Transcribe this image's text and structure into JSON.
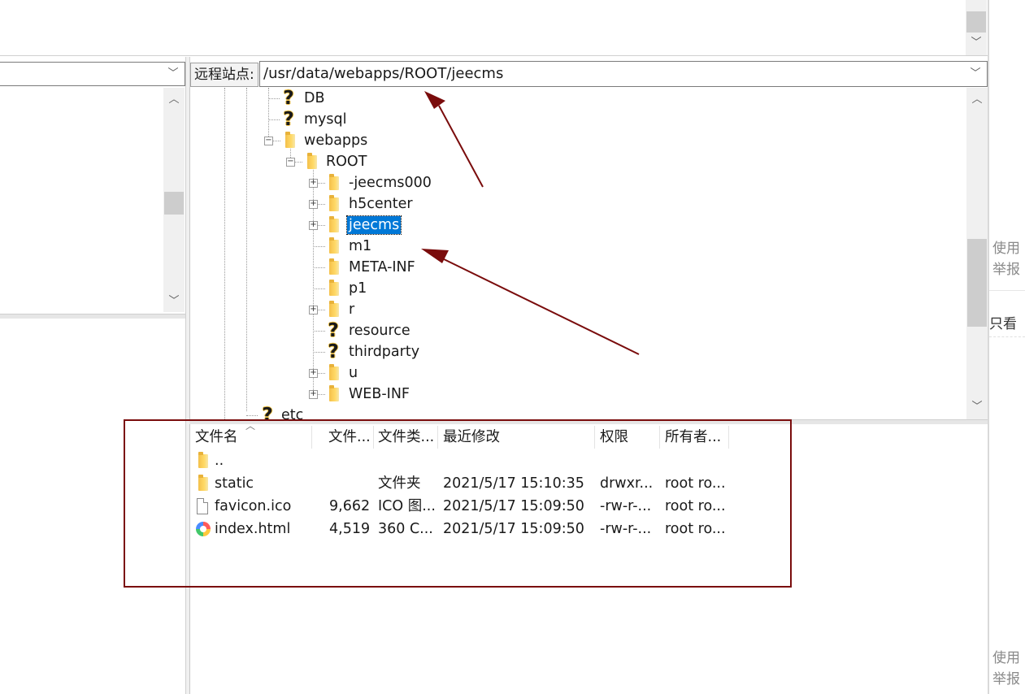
{
  "remote_site": {
    "label": "远程站点:",
    "path": "/usr/data/webapps/ROOT/jeecms"
  },
  "tree": {
    "items": [
      {
        "name": "DB",
        "icon": "question-icon"
      },
      {
        "name": "mysql",
        "icon": "question-icon"
      },
      {
        "name": "webapps",
        "icon": "folder-icon",
        "expander": "⊟"
      },
      {
        "name": "ROOT",
        "icon": "folder-icon",
        "expander": "⊟"
      },
      {
        "name": "-jeecms000",
        "icon": "folder-icon",
        "expander": "⊞"
      },
      {
        "name": "h5center",
        "icon": "folder-icon",
        "expander": "⊞"
      },
      {
        "name": "jeecms",
        "icon": "folder-icon",
        "expander": "⊞",
        "selected": true
      },
      {
        "name": "m1",
        "icon": "folder-icon"
      },
      {
        "name": "META-INF",
        "icon": "folder-icon"
      },
      {
        "name": "p1",
        "icon": "folder-icon"
      },
      {
        "name": "r",
        "icon": "folder-icon",
        "expander": "⊞"
      },
      {
        "name": "resource",
        "icon": "question-icon"
      },
      {
        "name": "thirdparty",
        "icon": "question-icon"
      },
      {
        "name": "u",
        "icon": "folder-icon",
        "expander": "⊞"
      },
      {
        "name": "WEB-INF",
        "icon": "folder-icon",
        "expander": "⊞"
      },
      {
        "name": "etc",
        "icon": "question-icon"
      }
    ]
  },
  "file_list": {
    "headers": {
      "name": "文件名",
      "size": "文件...",
      "type": "文件类...",
      "modified": "最近修改",
      "permissions": "权限",
      "owner": "所有者..."
    },
    "rows": [
      {
        "name": "..",
        "size": "",
        "type": "",
        "modified": "",
        "permissions": "",
        "owner": "",
        "icon": "folder-icon"
      },
      {
        "name": "static",
        "size": "",
        "type": "文件夹",
        "modified": "2021/5/17 15:10:35",
        "permissions": "drwxr...",
        "owner": "root ro...",
        "icon": "folder-icon"
      },
      {
        "name": "favicon.ico",
        "size": "9,662",
        "type": "ICO 图...",
        "modified": "2021/5/17 15:09:50",
        "permissions": "-rw-r-...",
        "owner": "root ro...",
        "icon": "file-icon"
      },
      {
        "name": "index.html",
        "size": "4,519",
        "type": "360 C...",
        "modified": "2021/5/17 15:09:50",
        "permissions": "-rw-r-...",
        "owner": "root ro...",
        "icon": "html-file-icon"
      }
    ]
  },
  "side_panel": {
    "top_use": "使用",
    "top_report": "举报",
    "only_look": "只看",
    "bottom_use": "使用",
    "bottom_report": "举报"
  },
  "colors": {
    "annotation_arrow": "#7a0c0c",
    "annotation_box": "#7a0c0c",
    "selection": "#0078d7"
  }
}
